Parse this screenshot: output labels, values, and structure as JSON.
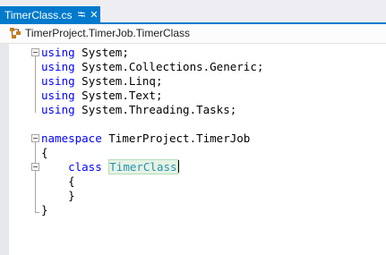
{
  "tab": {
    "title": "TimerClass.cs",
    "pin_icon": "pin-icon",
    "close_icon": "close-icon"
  },
  "navbar": {
    "class_icon": "class-icon",
    "member": "TimerProject.TimerJob.TimerClass"
  },
  "code": {
    "using_kw": "using",
    "usings": [
      "System;",
      "System.Collections.Generic;",
      "System.Linq;",
      "System.Text;",
      "System.Threading.Tasks;"
    ],
    "namespace_kw": "namespace",
    "namespace_name": "TimerProject.TimerJob",
    "open_brace": "{",
    "close_brace": "}",
    "class_kw": "class",
    "class_name": "TimerClass"
  },
  "colors": {
    "accent": "#007acc",
    "keyword": "#0000ff",
    "type": "#2b91af"
  }
}
